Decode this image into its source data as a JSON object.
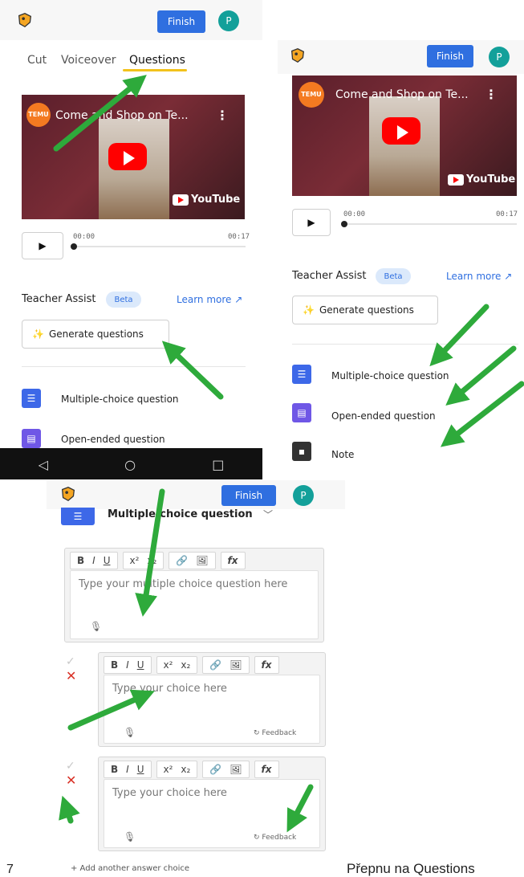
{
  "colors": {
    "accent": "#2f6fe0",
    "avatar": "#13a09a",
    "underline": "#f2c21b",
    "arrow": "#2eaa3b",
    "mcq": "#3d68e8",
    "open": "#6f57e6",
    "note": "#333333",
    "remove": "#d93025"
  },
  "header": {
    "finish_label": "Finish",
    "avatar_initial": "P"
  },
  "tabs": [
    {
      "label": "Cut"
    },
    {
      "label": "Voiceover"
    },
    {
      "label": "Questions"
    }
  ],
  "video": {
    "channel": "TEMU",
    "title": "Come and Shop on Te...",
    "platform": "YouTube",
    "time_start": "00:00",
    "time_end": "00:17",
    "progress": 0
  },
  "assist": {
    "title": "Teacher Assist",
    "badge": "Beta",
    "learn_more": "Learn more ↗",
    "generate_label": "Generate questions"
  },
  "question_types": [
    {
      "label": "Multiple-choice question",
      "icon": "list-icon"
    },
    {
      "label": "Open-ended question",
      "icon": "comment-icon"
    },
    {
      "label": "Note",
      "icon": "note-icon"
    }
  ],
  "editor": {
    "type_label": "Multiple-choice question",
    "toolbar": [
      "B",
      "I",
      "U",
      "x²",
      "x₂",
      "🔗",
      "🖼",
      "fx"
    ],
    "question_placeholder": "Type your multiple choice question here",
    "choice_placeholder": "Type your choice here",
    "feedback_label": "Feedback",
    "add_choice_label": "+ Add another answer choice"
  },
  "page_number": "7",
  "caption": "Přepnu na Questions"
}
